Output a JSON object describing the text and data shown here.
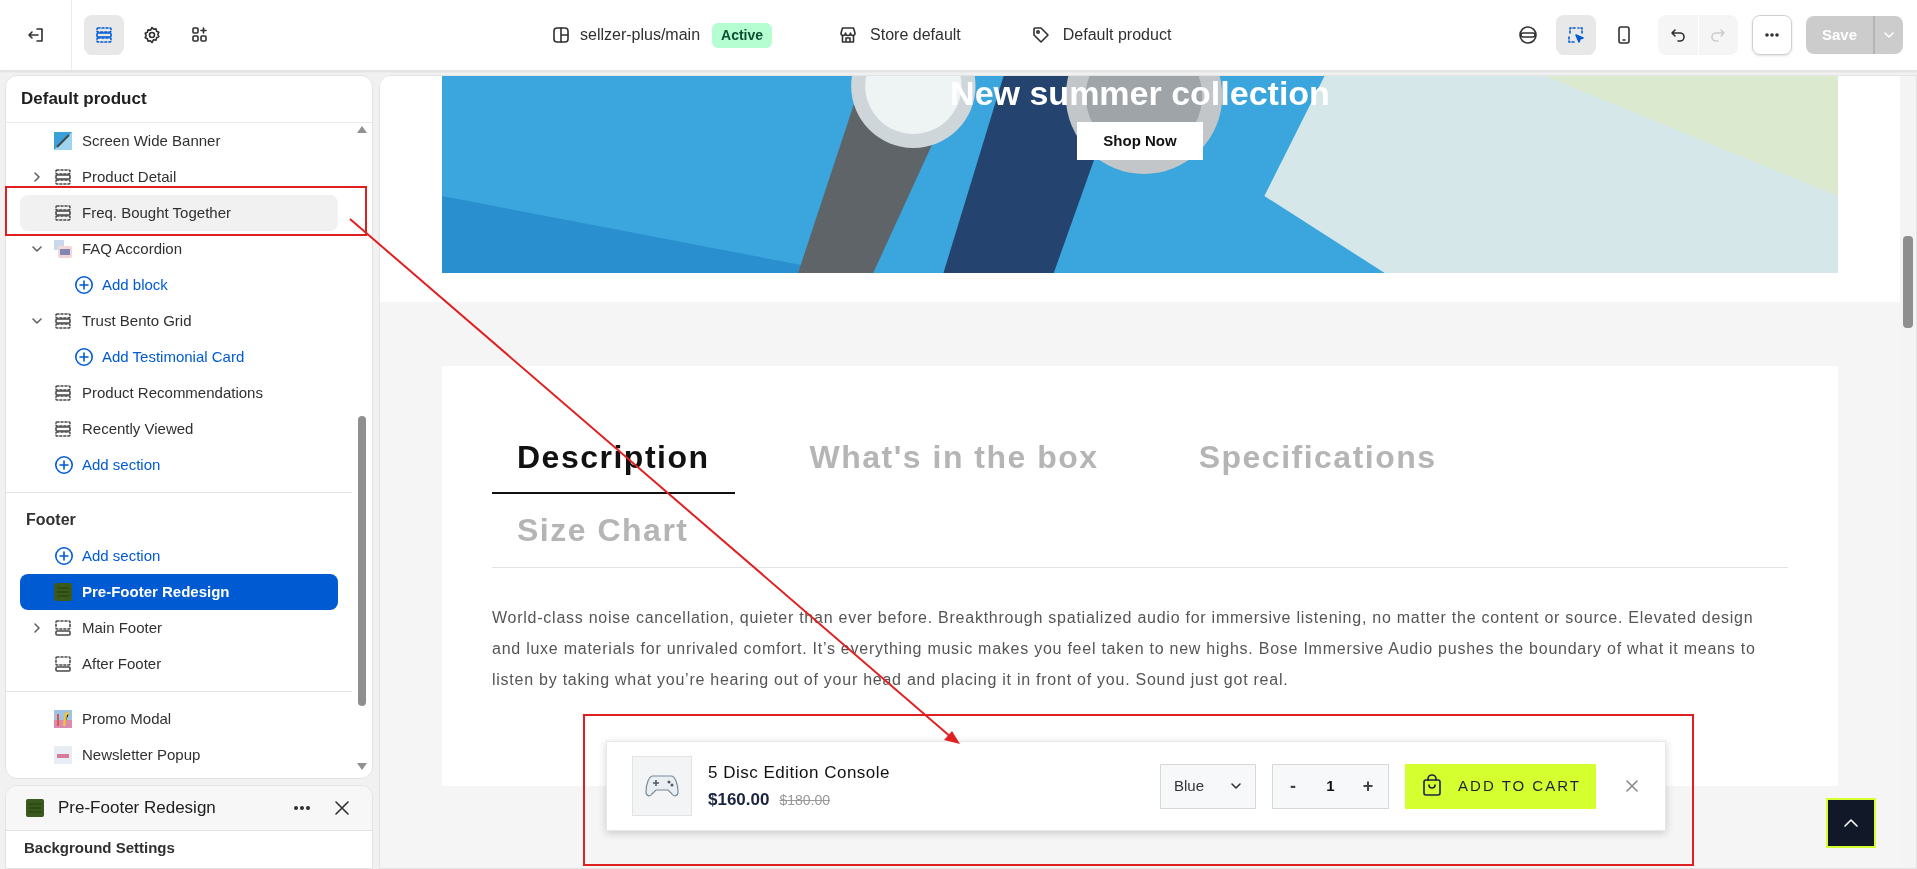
{
  "topbar": {
    "branch": "sellzer-plus/main",
    "branch_status": "Active",
    "store": "Store default",
    "template": "Default product",
    "save": "Save"
  },
  "tree": {
    "title": "Default product",
    "groups": [
      {
        "items": [
          {
            "kind": "section",
            "label": "Screen Wide Banner",
            "hovered": false
          },
          {
            "kind": "section",
            "label": "Product Detail",
            "expanded": false,
            "hovered": false
          },
          {
            "kind": "section",
            "label": "Freq. Bought Together",
            "hovered": true
          },
          {
            "kind": "section",
            "label": "FAQ Accordion",
            "expanded": true,
            "hovered": false,
            "children": [
              {
                "kind": "add",
                "label": "Add block"
              }
            ]
          },
          {
            "kind": "section",
            "label": "Trust Bento Grid",
            "expanded": true,
            "hovered": false,
            "children": [
              {
                "kind": "add",
                "label": "Add Testimonial Card"
              }
            ]
          },
          {
            "kind": "section",
            "label": "Product Recommendations",
            "hovered": false
          },
          {
            "kind": "section",
            "label": "Recently Viewed",
            "hovered": false
          },
          {
            "kind": "add",
            "label": "Add section"
          }
        ]
      },
      {
        "title": "Footer",
        "items": [
          {
            "kind": "add",
            "label": "Add section"
          },
          {
            "kind": "section",
            "label": "Pre-Footer Redesign",
            "selected": true,
            "hovered": false
          },
          {
            "kind": "section",
            "label": "Main Footer",
            "expanded": false,
            "selected": false,
            "hovered": false
          },
          {
            "kind": "section",
            "label": "After Footer",
            "selected": false,
            "hovered": false
          }
        ]
      },
      {
        "items": [
          {
            "kind": "section",
            "label": "Promo Modal",
            "hovered": false
          },
          {
            "kind": "section",
            "label": "Newsletter Popup",
            "hovered": false
          }
        ]
      }
    ]
  },
  "settings_panel": {
    "title": "Pre-Footer Redesign",
    "heading": "Background Settings"
  },
  "preview": {
    "banner": {
      "heading": "New summer collection",
      "button": "Shop Now"
    },
    "tabs": [
      {
        "label": "Description",
        "selected": true
      },
      {
        "label": "What's in the box",
        "selected": false
      },
      {
        "label": "Specifications",
        "selected": false
      },
      {
        "label": "Size Chart",
        "selected": false
      }
    ],
    "description": "World-class noise cancellation, quieter than ever before. Breakthrough spatialized audio for immersive listening, no matter the content or source. Elevated design and luxe materials for unrivaled comfort. It’s everything music makes you feel taken to new highs. Bose Immersive Audio pushes the boundary of what it means to listen by taking what you’re hearing out of your head and placing it in front of you. Sound just got real.",
    "sticky_cart": {
      "product": "5 Disc Edition Console",
      "price": "$160.00",
      "compare_price": "$180.00",
      "variant": "Blue",
      "minus": "-",
      "quantity": "1",
      "plus": "+",
      "button": "ADD TO CART"
    }
  }
}
